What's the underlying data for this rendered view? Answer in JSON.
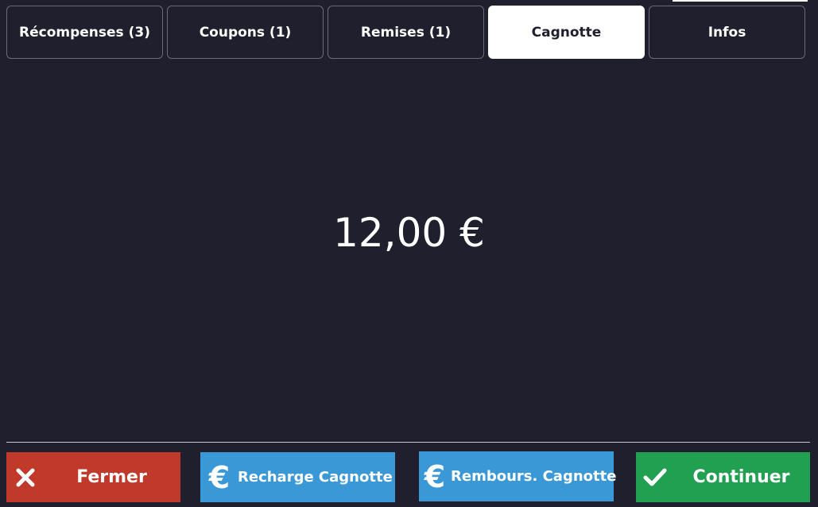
{
  "tabs": [
    {
      "label": "Récompenses (3)",
      "active": false
    },
    {
      "label": "Coupons (1)",
      "active": false
    },
    {
      "label": "Remises (1)",
      "active": false
    },
    {
      "label": "Cagnotte",
      "active": true
    },
    {
      "label": "Infos",
      "active": false
    }
  ],
  "balance": {
    "amount": "12,00 €"
  },
  "actions": {
    "close_label": "Fermer",
    "recharge_label": "Recharge Cagnotte",
    "refund_label": "Rembours. Cagnotte",
    "continue_label": "Continuer"
  },
  "icons": {
    "close": "close-icon",
    "recharge": "euro-icon",
    "refund": "euro-icon",
    "continue": "check-icon"
  },
  "colors": {
    "background": "#1f1f2e",
    "tab_active_bg": "#ffffff",
    "close_button": "#c0392b",
    "cagnotte_buttons": "#3b98d6",
    "continue_button": "#21a052"
  }
}
